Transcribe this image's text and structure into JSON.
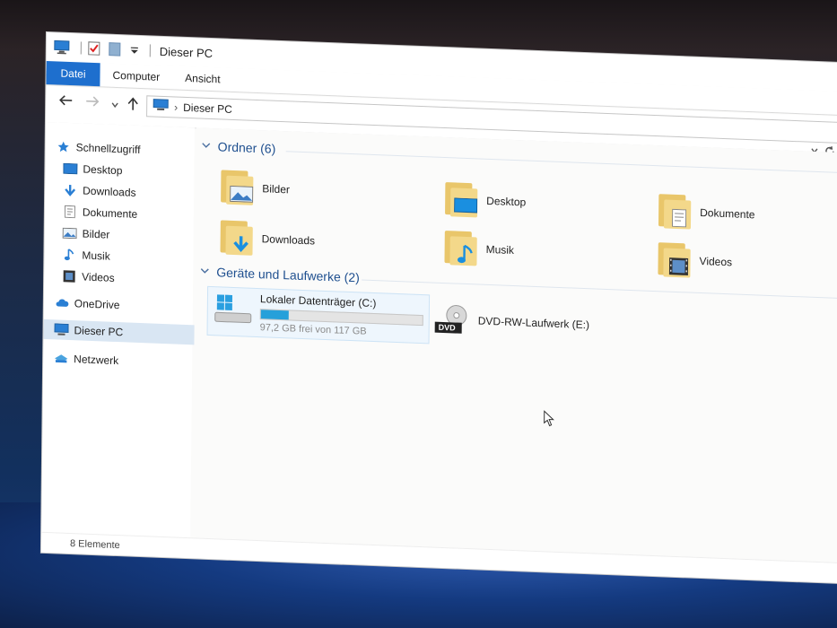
{
  "titlebar": {
    "title": "Dieser PC",
    "icons": [
      "computer-icon",
      "properties-icon",
      "new-folder-icon",
      "customize-quick-access-icon"
    ]
  },
  "ribbon": {
    "tabs": [
      {
        "label": "Datei",
        "active": true
      },
      {
        "label": "Computer",
        "active": false
      },
      {
        "label": "Ansicht",
        "active": false
      }
    ]
  },
  "nav": {
    "address_label": "Dieser PC",
    "buttons": [
      "back-arrow-icon",
      "forward-arrow-icon",
      "recent-dropdown-icon",
      "up-arrow-icon"
    ]
  },
  "sidebar": {
    "items": [
      {
        "label": "Schnellzugriff",
        "icon": "star-icon",
        "pinned": false
      },
      {
        "label": "Desktop",
        "icon": "desktop-icon",
        "pinned": true
      },
      {
        "label": "Downloads",
        "icon": "download-icon",
        "pinned": true
      },
      {
        "label": "Dokumente",
        "icon": "document-icon",
        "pinned": true
      },
      {
        "label": "Bilder",
        "icon": "picture-icon",
        "pinned": true
      },
      {
        "label": "Musik",
        "icon": "music-icon",
        "pinned": false
      },
      {
        "label": "Videos",
        "icon": "video-icon",
        "pinned": false
      },
      {
        "label": "OneDrive",
        "icon": "cloud-icon",
        "pinned": false
      },
      {
        "label": "Dieser PC",
        "icon": "computer-icon",
        "pinned": false,
        "selected": true
      },
      {
        "label": "Netzwerk",
        "icon": "network-icon",
        "pinned": false
      }
    ]
  },
  "content": {
    "folders_group": {
      "title": "Ordner (6)",
      "items": [
        {
          "label": "Bilder",
          "icon": "picture-icon"
        },
        {
          "label": "Desktop",
          "icon": "desktop-icon"
        },
        {
          "label": "Dokumente",
          "icon": "document-icon"
        },
        {
          "label": "Downloads",
          "icon": "download-icon"
        },
        {
          "label": "Musik",
          "icon": "music-icon"
        },
        {
          "label": "Videos",
          "icon": "video-icon"
        }
      ]
    },
    "drives_group": {
      "title": "Geräte und Laufwerke (2)",
      "drives": [
        {
          "label": "Lokaler Datenträger (C:)",
          "free_text": "97,2 GB frei von 117 GB",
          "used_fraction": 0.17,
          "icon": "windows-drive-icon"
        },
        {
          "label": "DVD-RW-Laufwerk (E:)",
          "icon": "dvd-drive-icon",
          "badge": "DVD"
        }
      ]
    }
  },
  "statusbar": {
    "text": "8 Elemente"
  },
  "colors": {
    "accent": "#1e6fce",
    "group_title": "#1e4f8f",
    "folder_yellow": "#f3d88a",
    "drive_fill": "#26a0da"
  }
}
